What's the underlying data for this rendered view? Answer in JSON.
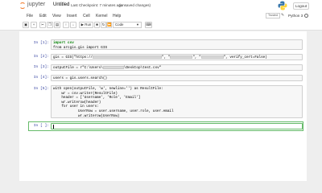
{
  "header": {
    "logo_text": "jupyter",
    "notebook_title": "Untitled",
    "checkpoint": "Last Checkpoint: 7 minutes ago",
    "autosave": "(unsaved changes)",
    "logout_label": "Logout"
  },
  "menubar": {
    "items": [
      "File",
      "Edit",
      "View",
      "Insert",
      "Cell",
      "Kernel",
      "Help"
    ],
    "trusted_label": "Trusted",
    "kernel_name": "Python 3"
  },
  "toolbar": {
    "run_label": "Run",
    "cell_type": "Code"
  },
  "cells": [
    {
      "prompt": "In [1]:",
      "lines": [
        "import csv",
        "from arcgis.gis import GIS"
      ]
    },
    {
      "prompt": "In [2]:",
      "lines": [
        "gis = GIS(\"https://",
        "\", \"",
        "\", \"",
        "\", verify_cert=False)"
      ]
    },
    {
      "prompt": "In [3]:",
      "lines": [
        "outputFile = r\"C:\\Users\\",
        "\\Desktop\\test.csv\""
      ]
    },
    {
      "prompt": "In [4]:",
      "lines": [
        "users = gis.users.search()"
      ]
    },
    {
      "prompt": "In [5]:",
      "lines": [
        "with open(outputFile, 'w', newline='') as ResultFile:",
        "    wr = csv.writer(ResultFile)",
        "    header = ['Username', 'Role', 'Email']",
        "    wr.writerow(header)",
        "    for user in users:",
        "            UserRow = user.username, user.role, user.email",
        "            wr.writerow(UserRow)"
      ]
    },
    {
      "prompt": "In [ ]:",
      "lines": [
        ""
      ]
    }
  ],
  "colors": {
    "prompt": "#303f9f",
    "keyword": "#008000",
    "string": "#ba2121",
    "active_cell_border": "#66bb6a",
    "jupyter_orange": "#f37726"
  }
}
